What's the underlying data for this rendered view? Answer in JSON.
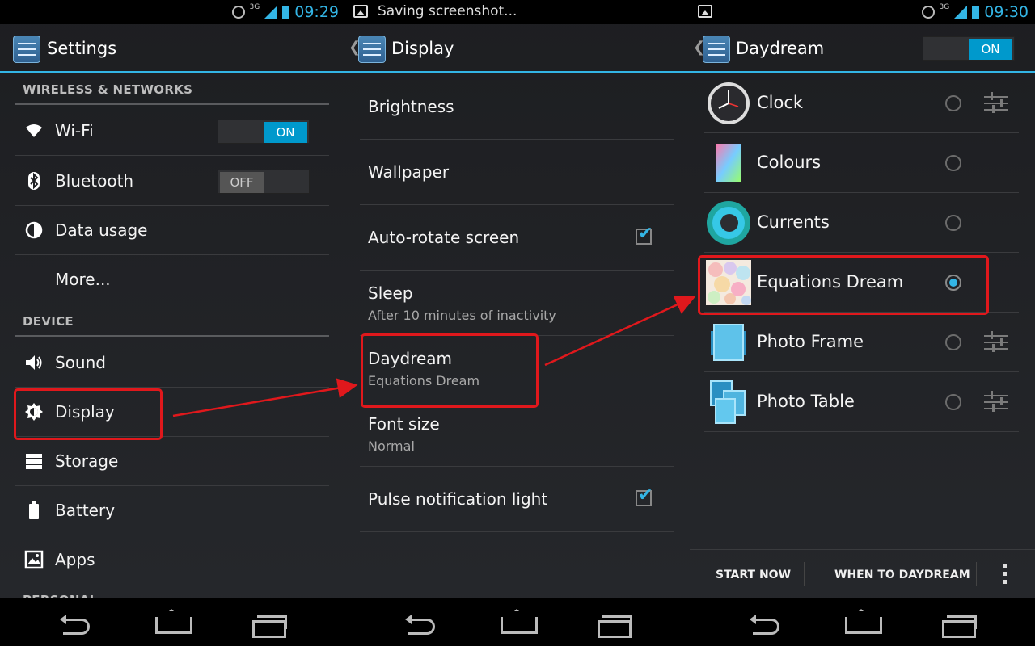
{
  "colors": {
    "accent": "#33b5e5",
    "highlight": "#e0181c",
    "background": "#1f2023"
  },
  "status": {
    "left_time": "09:29",
    "middle_message": "Saving screenshot...",
    "right_time": "09:30",
    "network": "3G"
  },
  "settings": {
    "title": "Settings",
    "sections": [
      "WIRELESS & NETWORKS",
      "DEVICE",
      "PERSONAL"
    ],
    "items": [
      {
        "label": "Wi-Fi",
        "icon": "wifi-icon",
        "toggle": "ON"
      },
      {
        "label": "Bluetooth",
        "icon": "bluetooth-icon",
        "toggle": "OFF"
      },
      {
        "label": "Data usage",
        "icon": "data-usage-icon"
      },
      {
        "label": "More..."
      },
      {
        "label": "Sound",
        "icon": "sound-icon"
      },
      {
        "label": "Display",
        "icon": "display-icon"
      },
      {
        "label": "Storage",
        "icon": "storage-icon"
      },
      {
        "label": "Battery",
        "icon": "battery-icon"
      },
      {
        "label": "Apps",
        "icon": "apps-icon"
      }
    ]
  },
  "display": {
    "title": "Display",
    "items": [
      {
        "title": "Brightness"
      },
      {
        "title": "Wallpaper"
      },
      {
        "title": "Auto-rotate screen",
        "checked": true
      },
      {
        "title": "Sleep",
        "sub": "After 10 minutes of inactivity"
      },
      {
        "title": "Daydream",
        "sub": "Equations Dream"
      },
      {
        "title": "Font size",
        "sub": "Normal"
      },
      {
        "title": "Pulse notification light",
        "checked": true
      }
    ]
  },
  "daydream": {
    "title": "Daydream",
    "toggle": "ON",
    "selected": "Equations Dream",
    "options": [
      {
        "label": "Clock",
        "icon": "clock-icon",
        "settings": true
      },
      {
        "label": "Colours",
        "icon": "colours-icon",
        "settings": false
      },
      {
        "label": "Currents",
        "icon": "currents-icon",
        "settings": false
      },
      {
        "label": "Equations Dream",
        "icon": "equations-dream-icon",
        "settings": false
      },
      {
        "label": "Photo Frame",
        "icon": "photo-frame-icon",
        "settings": true
      },
      {
        "label": "Photo Table",
        "icon": "photo-table-icon",
        "settings": true
      }
    ],
    "start_now": "START NOW",
    "when_to_daydream": "WHEN TO DAYDREAM"
  }
}
